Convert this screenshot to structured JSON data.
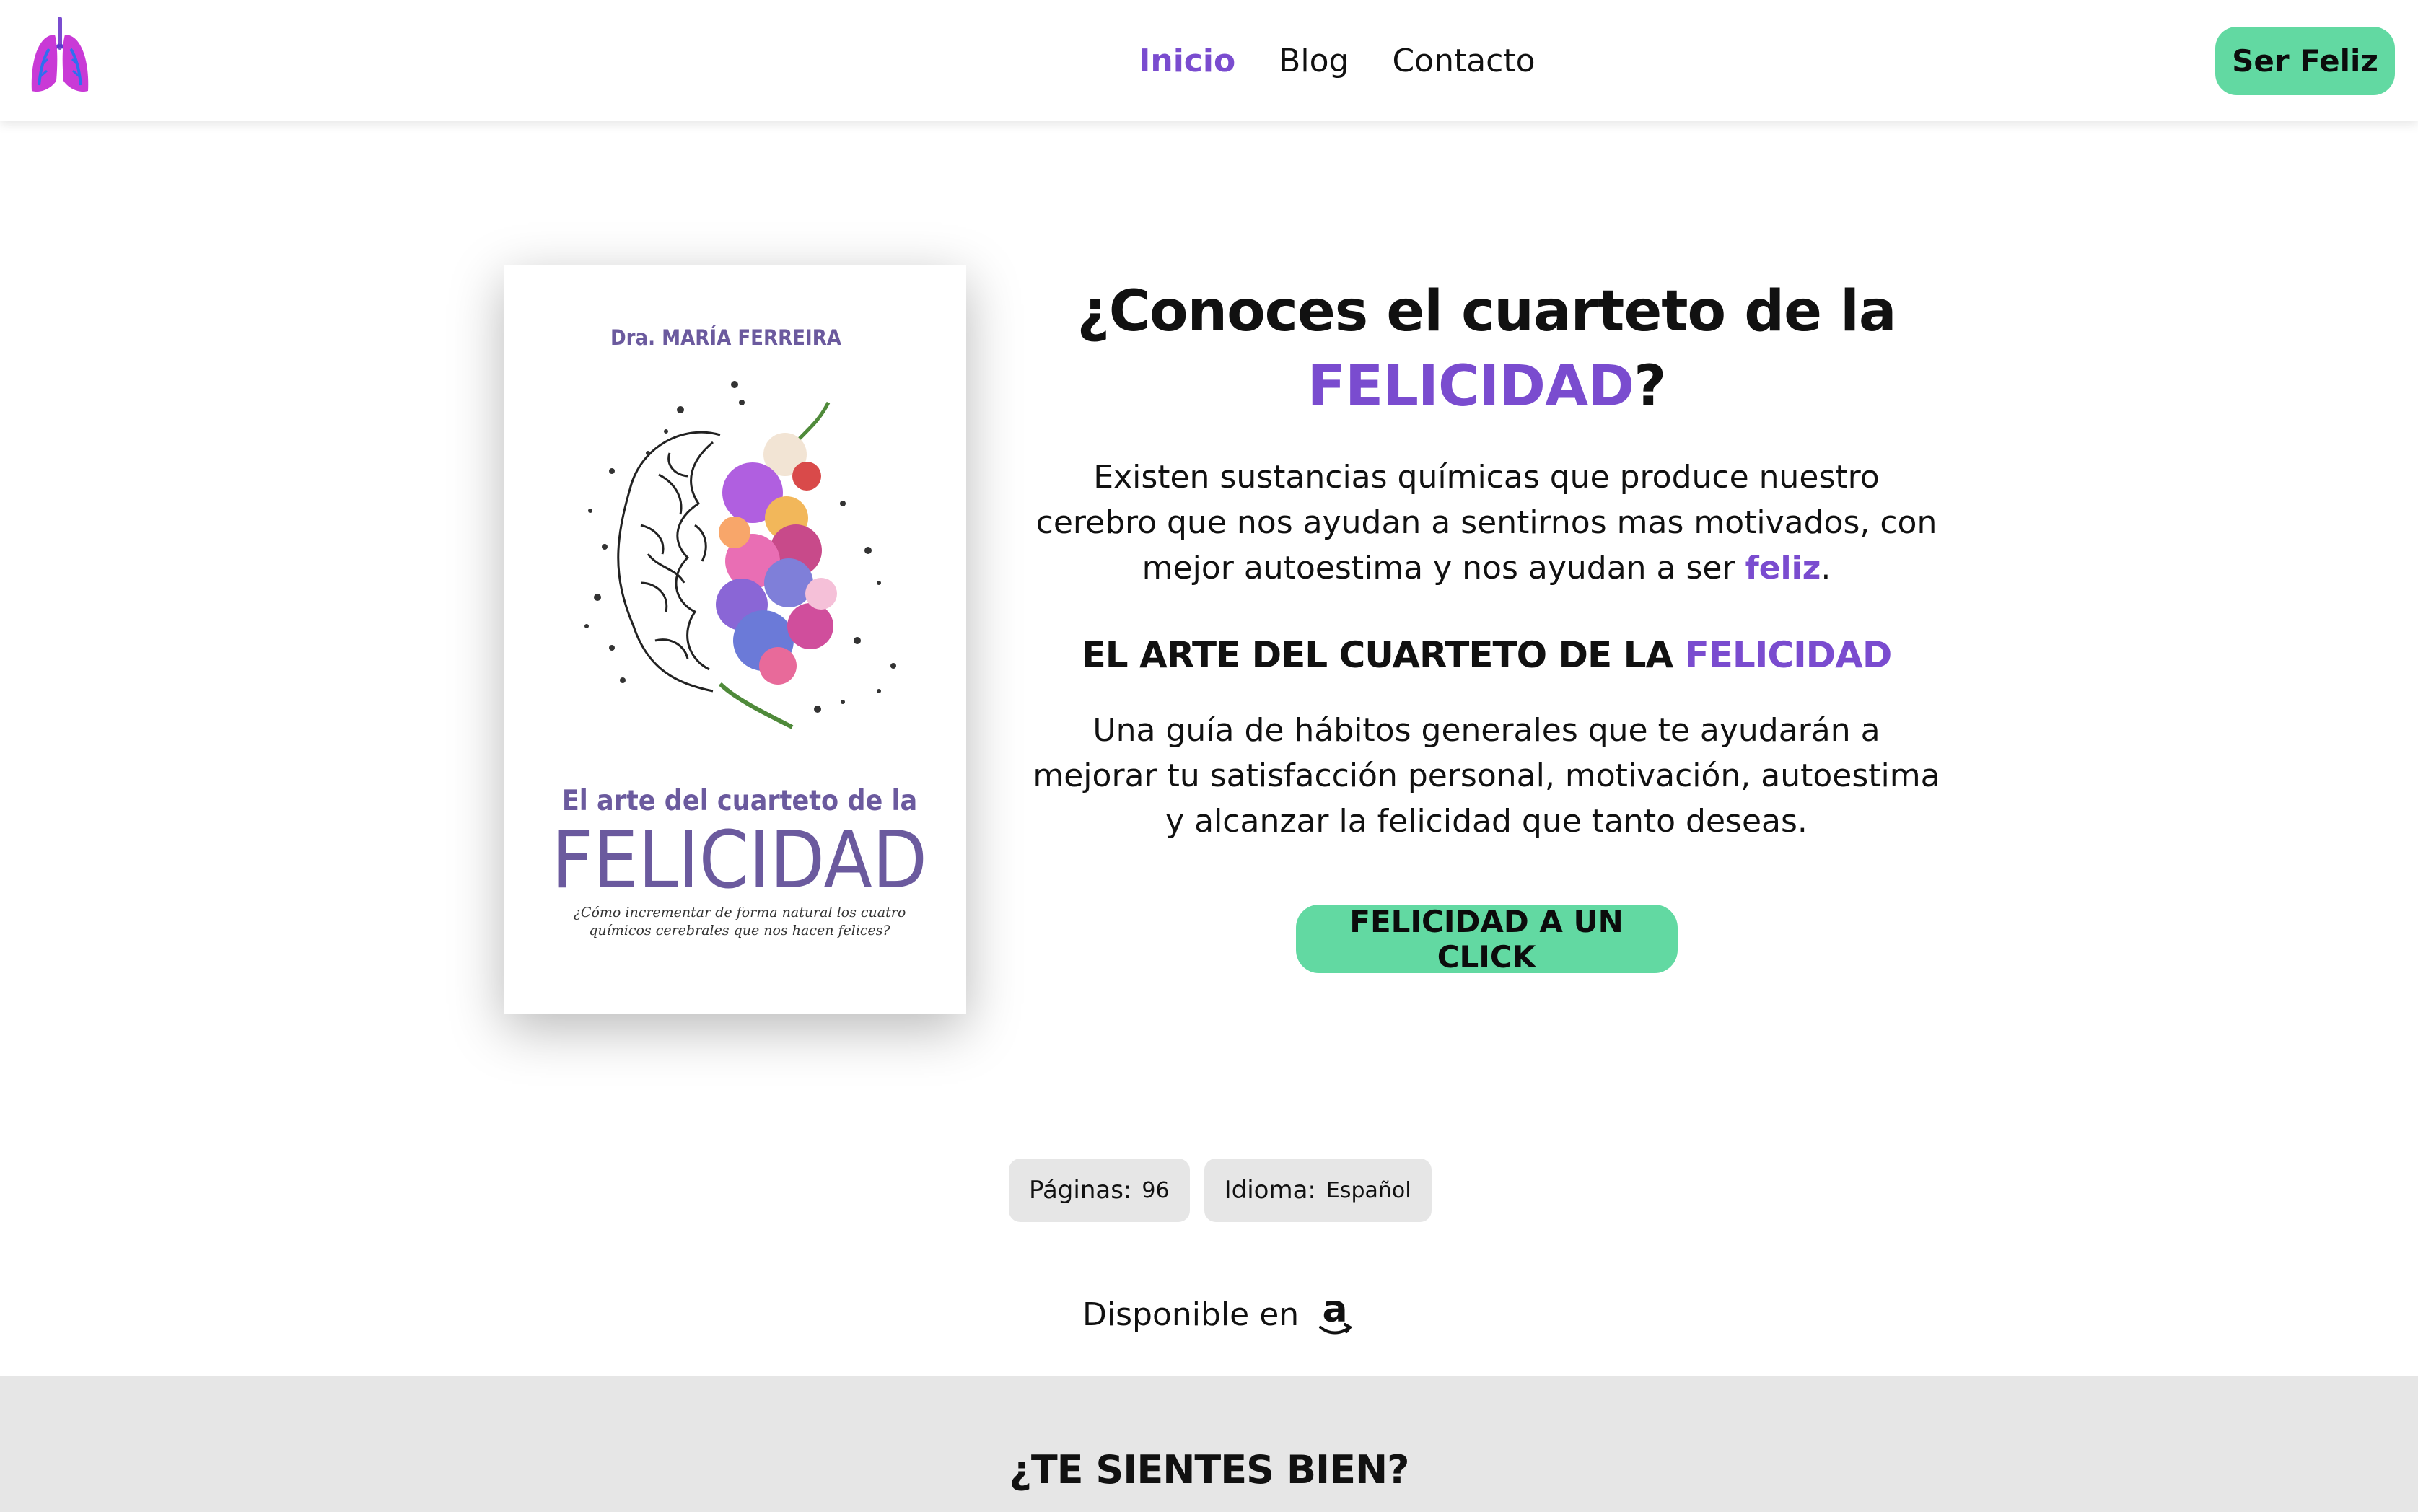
{
  "header": {
    "logo_icon": "lungs-logo-icon",
    "nav": [
      {
        "label": "Inicio",
        "active": true
      },
      {
        "label": "Blog",
        "active": false
      },
      {
        "label": "Contacto",
        "active": false
      }
    ],
    "cta_label": "Ser Feliz"
  },
  "book": {
    "author": "Dra. MARÍA FERREIRA",
    "title_line": "El arte del cuarteto de la",
    "title_big": "FELICIDAD",
    "subtitle_1": "¿Cómo incrementar de forma natural los cuatro",
    "subtitle_2": "químicos cerebrales que nos hacen felices?"
  },
  "hero": {
    "title_part1": "¿Conoces el cuarteto de la",
    "title_highlight": "FELICIDAD",
    "title_end": "?",
    "paragraph_1": "Existen sustancias químicas que produce nuestro cerebro que nos ayudan a sentirnos mas motivados, con mejor autoestima y nos ayudan a ser",
    "paragraph_1_highlight": "feliz",
    "paragraph_1_end": ".",
    "subtitle_part1": "EL ARTE DEL CUARTETO DE LA",
    "subtitle_highlight": "FELICIDAD",
    "paragraph_2": "Una guía de hábitos generales que te ayudarán a mejorar tu satisfacción personal, motivación, autoestima y alcanzar la felicidad que tanto deseas.",
    "cta_label": "FELICIDAD A UN CLICK"
  },
  "meta": {
    "pages_label": "Páginas:",
    "pages_value": "96",
    "language_label": "Idioma:",
    "language_value": "Español"
  },
  "availability": {
    "label": "Disponible en",
    "store_icon": "amazon-icon"
  },
  "section": {
    "title": "¿TE SIENTES BIEN?"
  },
  "colors": {
    "accent": "#7a4ccf",
    "button": "#62d9a2",
    "band": "#e6e6e6"
  }
}
